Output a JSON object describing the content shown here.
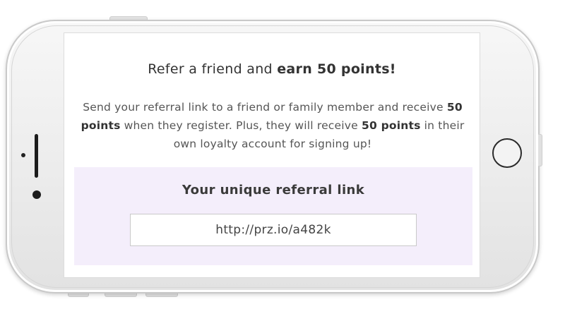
{
  "referral": {
    "headline_prefix": "Refer a friend and ",
    "headline_bold": "earn 50 points!",
    "desc_part1": "Send your referral link to a friend or family member and receive ",
    "desc_bold1": "50 points",
    "desc_part2": " when they register. Plus, they will receive ",
    "desc_bold2": "50 points",
    "desc_part3": " in their own loyalty account for signing up!"
  },
  "link_panel": {
    "title": "Your unique referral link",
    "link_value": "http://prz.io/a482k"
  },
  "device": {
    "type": "iphone-landscape",
    "frame_color": "#ececec",
    "screen_bg": "#ffffff",
    "panel_bg": "#f4eefb"
  }
}
